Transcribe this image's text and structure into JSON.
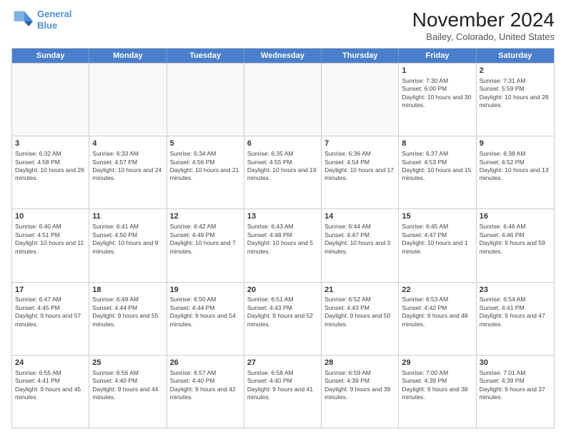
{
  "header": {
    "logo_line1": "General",
    "logo_line2": "Blue",
    "month_title": "November 2024",
    "location": "Bailey, Colorado, United States"
  },
  "days_of_week": [
    "Sunday",
    "Monday",
    "Tuesday",
    "Wednesday",
    "Thursday",
    "Friday",
    "Saturday"
  ],
  "weeks": [
    [
      {
        "day": "",
        "empty": true
      },
      {
        "day": "",
        "empty": true
      },
      {
        "day": "",
        "empty": true
      },
      {
        "day": "",
        "empty": true
      },
      {
        "day": "",
        "empty": true
      },
      {
        "day": "1",
        "sunrise": "Sunrise: 7:30 AM",
        "sunset": "Sunset: 6:00 PM",
        "daylight": "Daylight: 10 hours and 30 minutes."
      },
      {
        "day": "2",
        "sunrise": "Sunrise: 7:31 AM",
        "sunset": "Sunset: 5:59 PM",
        "daylight": "Daylight: 10 hours and 28 minutes."
      }
    ],
    [
      {
        "day": "3",
        "sunrise": "Sunrise: 6:32 AM",
        "sunset": "Sunset: 4:58 PM",
        "daylight": "Daylight: 10 hours and 26 minutes."
      },
      {
        "day": "4",
        "sunrise": "Sunrise: 6:33 AM",
        "sunset": "Sunset: 4:57 PM",
        "daylight": "Daylight: 10 hours and 24 minutes."
      },
      {
        "day": "5",
        "sunrise": "Sunrise: 6:34 AM",
        "sunset": "Sunset: 4:56 PM",
        "daylight": "Daylight: 10 hours and 21 minutes."
      },
      {
        "day": "6",
        "sunrise": "Sunrise: 6:35 AM",
        "sunset": "Sunset: 4:55 PM",
        "daylight": "Daylight: 10 hours and 19 minutes."
      },
      {
        "day": "7",
        "sunrise": "Sunrise: 6:36 AM",
        "sunset": "Sunset: 4:54 PM",
        "daylight": "Daylight: 10 hours and 17 minutes."
      },
      {
        "day": "8",
        "sunrise": "Sunrise: 6:37 AM",
        "sunset": "Sunset: 4:53 PM",
        "daylight": "Daylight: 10 hours and 15 minutes."
      },
      {
        "day": "9",
        "sunrise": "Sunrise: 6:38 AM",
        "sunset": "Sunset: 4:52 PM",
        "daylight": "Daylight: 10 hours and 13 minutes."
      }
    ],
    [
      {
        "day": "10",
        "sunrise": "Sunrise: 6:40 AM",
        "sunset": "Sunset: 4:51 PM",
        "daylight": "Daylight: 10 hours and 11 minutes."
      },
      {
        "day": "11",
        "sunrise": "Sunrise: 6:41 AM",
        "sunset": "Sunset: 4:50 PM",
        "daylight": "Daylight: 10 hours and 9 minutes."
      },
      {
        "day": "12",
        "sunrise": "Sunrise: 6:42 AM",
        "sunset": "Sunset: 4:49 PM",
        "daylight": "Daylight: 10 hours and 7 minutes."
      },
      {
        "day": "13",
        "sunrise": "Sunrise: 6:43 AM",
        "sunset": "Sunset: 4:48 PM",
        "daylight": "Daylight: 10 hours and 5 minutes."
      },
      {
        "day": "14",
        "sunrise": "Sunrise: 6:44 AM",
        "sunset": "Sunset: 4:47 PM",
        "daylight": "Daylight: 10 hours and 3 minutes."
      },
      {
        "day": "15",
        "sunrise": "Sunrise: 6:45 AM",
        "sunset": "Sunset: 4:47 PM",
        "daylight": "Daylight: 10 hours and 1 minute."
      },
      {
        "day": "16",
        "sunrise": "Sunrise: 6:46 AM",
        "sunset": "Sunset: 4:46 PM",
        "daylight": "Daylight: 9 hours and 59 minutes."
      }
    ],
    [
      {
        "day": "17",
        "sunrise": "Sunrise: 6:47 AM",
        "sunset": "Sunset: 4:45 PM",
        "daylight": "Daylight: 9 hours and 57 minutes."
      },
      {
        "day": "18",
        "sunrise": "Sunrise: 6:49 AM",
        "sunset": "Sunset: 4:44 PM",
        "daylight": "Daylight: 9 hours and 55 minutes."
      },
      {
        "day": "19",
        "sunrise": "Sunrise: 6:50 AM",
        "sunset": "Sunset: 4:44 PM",
        "daylight": "Daylight: 9 hours and 54 minutes."
      },
      {
        "day": "20",
        "sunrise": "Sunrise: 6:51 AM",
        "sunset": "Sunset: 4:43 PM",
        "daylight": "Daylight: 9 hours and 52 minutes."
      },
      {
        "day": "21",
        "sunrise": "Sunrise: 6:52 AM",
        "sunset": "Sunset: 4:43 PM",
        "daylight": "Daylight: 9 hours and 50 minutes."
      },
      {
        "day": "22",
        "sunrise": "Sunrise: 6:53 AM",
        "sunset": "Sunset: 4:42 PM",
        "daylight": "Daylight: 9 hours and 48 minutes."
      },
      {
        "day": "23",
        "sunrise": "Sunrise: 6:54 AM",
        "sunset": "Sunset: 4:41 PM",
        "daylight": "Daylight: 9 hours and 47 minutes."
      }
    ],
    [
      {
        "day": "24",
        "sunrise": "Sunrise: 6:55 AM",
        "sunset": "Sunset: 4:41 PM",
        "daylight": "Daylight: 9 hours and 45 minutes."
      },
      {
        "day": "25",
        "sunrise": "Sunrise: 6:56 AM",
        "sunset": "Sunset: 4:40 PM",
        "daylight": "Daylight: 9 hours and 44 minutes."
      },
      {
        "day": "26",
        "sunrise": "Sunrise: 6:57 AM",
        "sunset": "Sunset: 4:40 PM",
        "daylight": "Daylight: 9 hours and 42 minutes."
      },
      {
        "day": "27",
        "sunrise": "Sunrise: 6:58 AM",
        "sunset": "Sunset: 4:40 PM",
        "daylight": "Daylight: 9 hours and 41 minutes."
      },
      {
        "day": "28",
        "sunrise": "Sunrise: 6:59 AM",
        "sunset": "Sunset: 4:39 PM",
        "daylight": "Daylight: 9 hours and 39 minutes."
      },
      {
        "day": "29",
        "sunrise": "Sunrise: 7:00 AM",
        "sunset": "Sunset: 4:39 PM",
        "daylight": "Daylight: 9 hours and 38 minutes."
      },
      {
        "day": "30",
        "sunrise": "Sunrise: 7:01 AM",
        "sunset": "Sunset: 4:39 PM",
        "daylight": "Daylight: 9 hours and 37 minutes."
      }
    ]
  ]
}
